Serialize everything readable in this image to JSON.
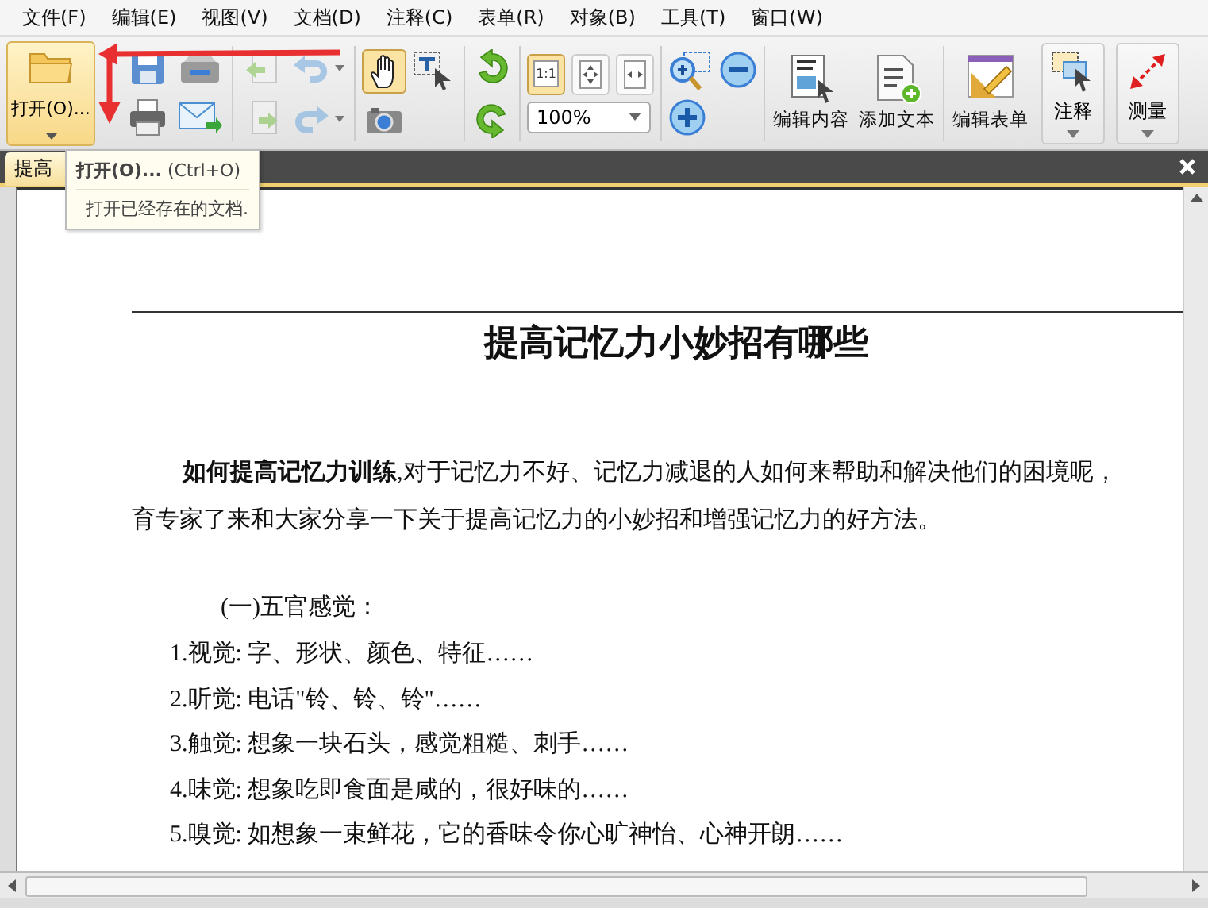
{
  "menu": [
    "文件(F)",
    "编辑(E)",
    "视图(V)",
    "文档(D)",
    "注释(C)",
    "表单(R)",
    "对象(B)",
    "工具(T)",
    "窗口(W)"
  ],
  "open_button": {
    "label": "打开(O)..."
  },
  "small_tools": [
    {
      "kind": "save",
      "selected": false
    },
    {
      "kind": "scan",
      "selected": false
    },
    {
      "kind": "print",
      "selected": false
    },
    {
      "kind": "email",
      "selected": false
    },
    {
      "kind": "prev-page",
      "selected": false
    },
    {
      "kind": "undo",
      "selected": false
    },
    {
      "kind": "next-page",
      "selected": false
    },
    {
      "kind": "redo",
      "selected": false
    },
    {
      "kind": "hand",
      "selected": true
    },
    {
      "kind": "select-text",
      "selected": false
    },
    {
      "kind": "camera",
      "selected": false
    },
    {
      "kind": "rotate-left",
      "selected": false
    },
    {
      "kind": "rotate-right",
      "selected": false
    }
  ],
  "view_buttons": [
    {
      "kind": "actual-size",
      "label": "1:1",
      "selected": true
    },
    {
      "kind": "fit-page",
      "selected": false
    },
    {
      "kind": "fit-width",
      "selected": false
    }
  ],
  "zoom": {
    "value": "100%"
  },
  "zoom_tools": [
    {
      "kind": "zoom-area"
    },
    {
      "kind": "zoom-out"
    },
    {
      "kind": "zoom-in"
    }
  ],
  "big_buttons": [
    {
      "kind": "edit-content",
      "label": "编辑内容"
    },
    {
      "kind": "add-text",
      "label": "添加文本"
    },
    {
      "kind": "edit-form",
      "label": "编辑表单"
    }
  ],
  "dropdown_buttons": [
    {
      "kind": "comment",
      "label": "注释"
    },
    {
      "kind": "measure",
      "label": "测量"
    }
  ],
  "tabs": [
    {
      "label": "提高",
      "selected": true
    }
  ],
  "tooltip": {
    "title": "打开(O)...",
    "shortcut": "(Ctrl+O)",
    "description": "打开已经存在的文档."
  },
  "document": {
    "title": "提高记忆力小妙招有哪些",
    "intro_lines": [
      "**如何提高记忆力训练**,对于记忆力不好、记忆力减退的人如何来帮助和解决他们的困境呢，",
      "育专家了来和大家分享一下关于提高记忆力的小妙招和增强记忆力的好方法。"
    ],
    "section_heading": "(一)五官感觉：",
    "items": [
      "1.视觉: 字、形状、颜色、特征……",
      "2.听觉: 电话\"铃、铃、铃\"……",
      "3.触觉: 想象一块石头，感觉粗糙、刺手……",
      "4.味觉: 想象吃即食面是咸的，很好味的……",
      "5.嗅觉: 如想象一束鲜花，它的香味令你心旷神怡、心神开朗……"
    ]
  }
}
